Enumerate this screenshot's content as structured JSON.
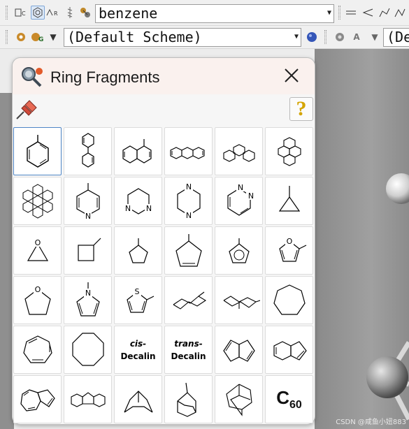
{
  "toolbar1": {
    "template_value": "benzene",
    "icons": [
      "template-icon",
      "ring-tool-icon",
      "chain-tool-icon",
      "bond-rotate-icon",
      "fragment-icon",
      "bond-length-icon",
      "bond-angle-icon",
      "dihedral-icon"
    ]
  },
  "toolbar2": {
    "scheme_value": "(Default Scheme)",
    "scheme_value_2": "(De",
    "icons": [
      "style-icon",
      "color-icon",
      "dropdown-arrow-icon",
      "globe-icon",
      "atom-icon",
      "label-icon"
    ]
  },
  "panel": {
    "title": "Ring Fragments",
    "help_label": "?",
    "tiles": [
      {
        "id": "toluene",
        "selected": true
      },
      {
        "id": "biphenyl"
      },
      {
        "id": "methylnaphthalene"
      },
      {
        "id": "anthracene"
      },
      {
        "id": "phenanthrene"
      },
      {
        "id": "pyrene"
      },
      {
        "id": "coronene"
      },
      {
        "id": "methylpyridine",
        "label": "N"
      },
      {
        "id": "pyrimidine",
        "labels": [
          "N",
          "N"
        ]
      },
      {
        "id": "pyrazine",
        "labels": [
          "N",
          "N"
        ]
      },
      {
        "id": "pyridazine",
        "labels": [
          "N",
          "N"
        ]
      },
      {
        "id": "methylcyclopropane"
      },
      {
        "id": "oxirane",
        "label": "O"
      },
      {
        "id": "methylcyclobutane"
      },
      {
        "id": "methylcyclopentane"
      },
      {
        "id": "methylcyclopentene"
      },
      {
        "id": "methylcyclopentadienyl"
      },
      {
        "id": "methylfuran",
        "label": "O"
      },
      {
        "id": "tetrahydrofuran",
        "label": "O"
      },
      {
        "id": "methylpyrrole",
        "label": "N"
      },
      {
        "id": "methylthiophene",
        "label": "S"
      },
      {
        "id": "methylcyclohexane-chair"
      },
      {
        "id": "methylcyclohexane-chair-2"
      },
      {
        "id": "cycloheptane"
      },
      {
        "id": "cycloheptatriene"
      },
      {
        "id": "cyclooctane"
      },
      {
        "id": "cis-decalin",
        "line1": "cis-",
        "line2": "Decalin"
      },
      {
        "id": "trans-decalin",
        "line1": "trans-",
        "line2": "Decalin"
      },
      {
        "id": "pentalene"
      },
      {
        "id": "indene"
      },
      {
        "id": "azulene"
      },
      {
        "id": "fluorene"
      },
      {
        "id": "norbornane"
      },
      {
        "id": "bicyclooctane"
      },
      {
        "id": "adamantane"
      },
      {
        "id": "c60",
        "text": "C",
        "sub": "60"
      }
    ]
  },
  "watermark": "CSDN @咸鱼小妞883"
}
